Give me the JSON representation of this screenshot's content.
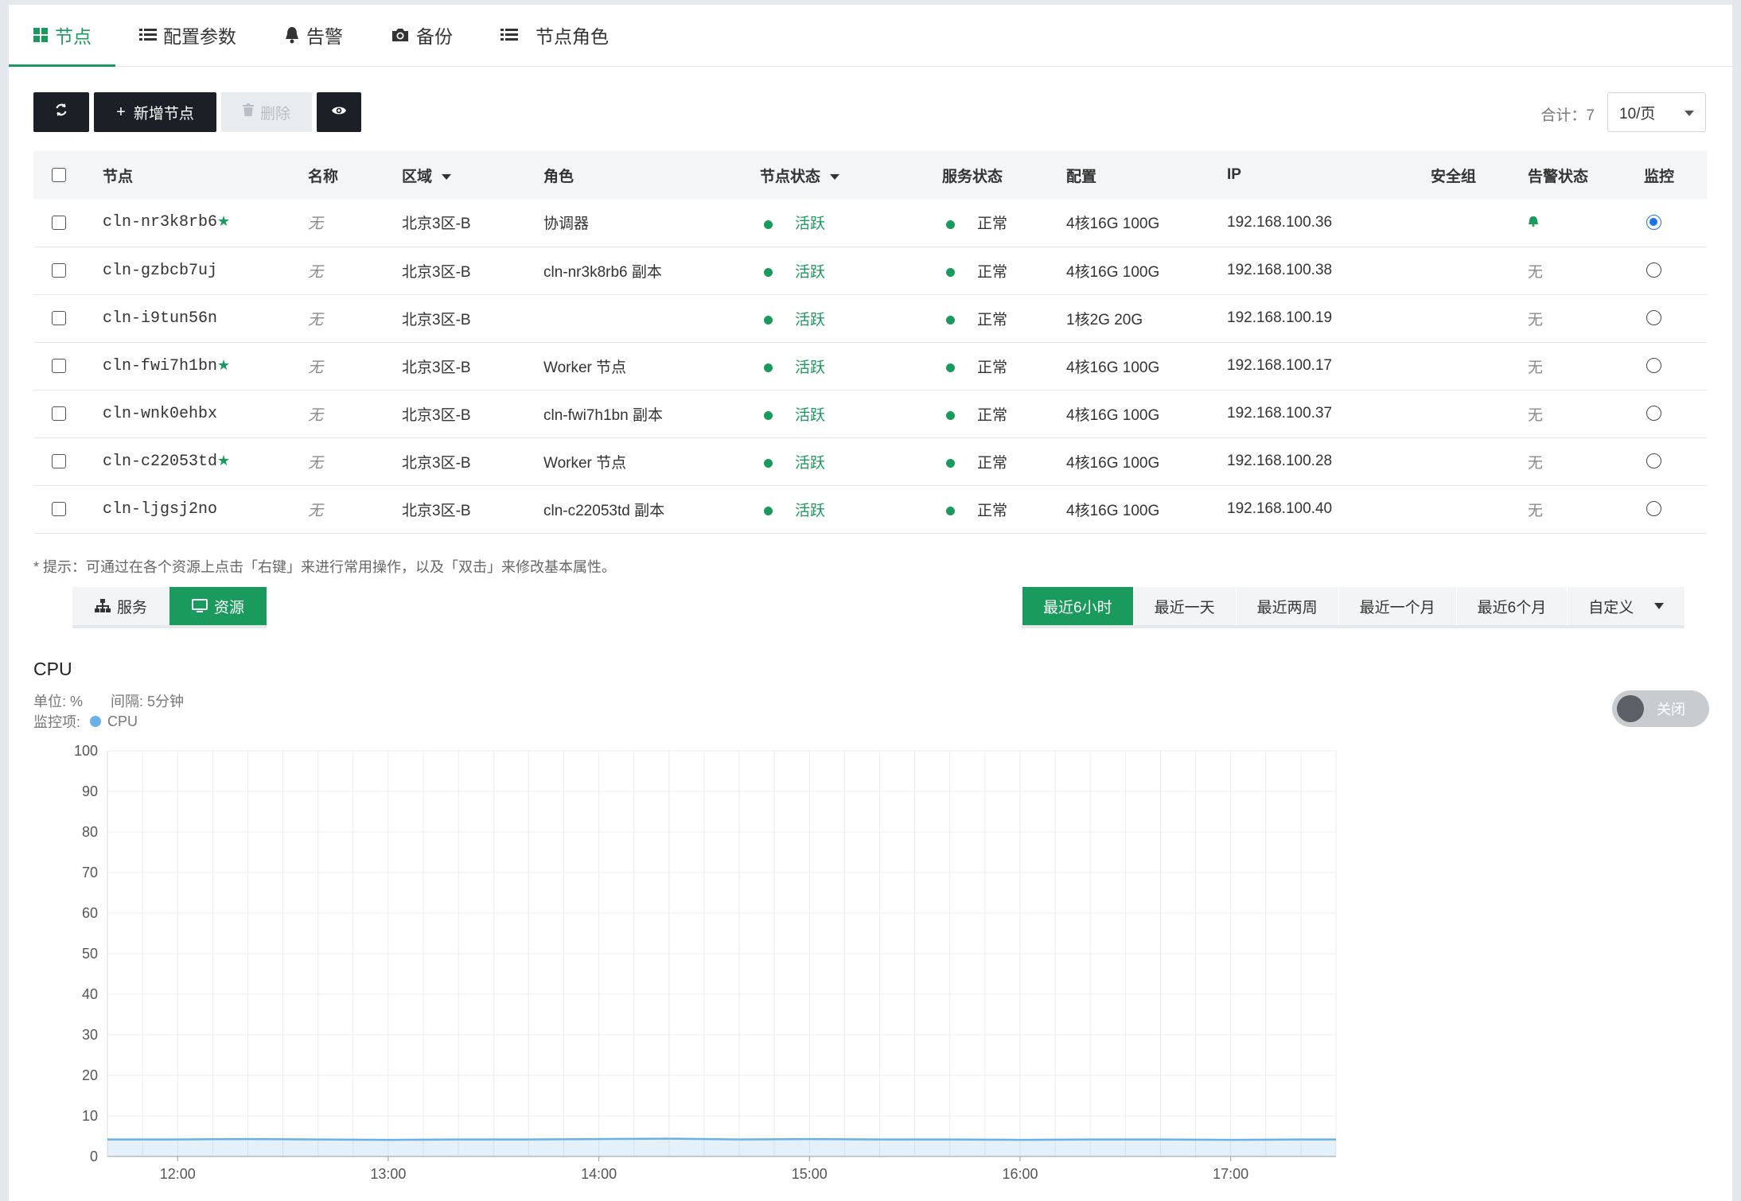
{
  "tabs": [
    {
      "label": "节点",
      "icon": "grid-icon"
    },
    {
      "label": "配置参数",
      "icon": "list-icon"
    },
    {
      "label": "告警",
      "icon": "bell-icon"
    },
    {
      "label": "备份",
      "icon": "camera-icon"
    },
    {
      "label": "节点角色",
      "icon": "list-icon"
    }
  ],
  "toolbar": {
    "add_label": "新增节点",
    "delete_label": "删除",
    "total": "合计：7",
    "per_page": "10/页"
  },
  "table": {
    "headers": [
      "节点",
      "名称",
      "区域",
      "角色",
      "节点状态",
      "服务状态",
      "配置",
      "IP",
      "安全组",
      "告警状态",
      "监控"
    ],
    "rows": [
      {
        "node": "cln-nr3k8rb6",
        "star": "★",
        "name": "无",
        "zone": "北京3区-B",
        "role": "协调器",
        "node_status": "活跃",
        "service_status": "正常",
        "config": "4核16G 100G",
        "ip": "192.168.100.36",
        "alarm": "",
        "monitor": true
      },
      {
        "node": "cln-gzbcb7uj",
        "star": "",
        "name": "无",
        "zone": "北京3区-B",
        "role": "cln-nr3k8rb6 副本",
        "node_status": "活跃",
        "service_status": "正常",
        "config": "4核16G 100G",
        "ip": "192.168.100.38",
        "alarm": "无",
        "monitor": false
      },
      {
        "node": "cln-i9tun56n",
        "star": "",
        "name": "无",
        "zone": "北京3区-B",
        "role": "",
        "node_status": "活跃",
        "service_status": "正常",
        "config": "1核2G 20G",
        "ip": "192.168.100.19",
        "alarm": "无",
        "monitor": false
      },
      {
        "node": "cln-fwi7h1bn",
        "star": "★",
        "name": "无",
        "zone": "北京3区-B",
        "role": "Worker 节点",
        "node_status": "活跃",
        "service_status": "正常",
        "config": "4核16G 100G",
        "ip": "192.168.100.17",
        "alarm": "无",
        "monitor": false
      },
      {
        "node": "cln-wnk0ehbx",
        "star": "",
        "name": "无",
        "zone": "北京3区-B",
        "role": "cln-fwi7h1bn 副本",
        "node_status": "活跃",
        "service_status": "正常",
        "config": "4核16G 100G",
        "ip": "192.168.100.37",
        "alarm": "无",
        "monitor": false
      },
      {
        "node": "cln-c22053td",
        "star": "★",
        "name": "无",
        "zone": "北京3区-B",
        "role": "Worker 节点",
        "node_status": "活跃",
        "service_status": "正常",
        "config": "4核16G 100G",
        "ip": "192.168.100.28",
        "alarm": "无",
        "monitor": false
      },
      {
        "node": "cln-ljgsj2no",
        "star": "",
        "name": "无",
        "zone": "北京3区-B",
        "role": "cln-c22053td 副本",
        "node_status": "活跃",
        "service_status": "正常",
        "config": "4核16G 100G",
        "ip": "192.168.100.40",
        "alarm": "无",
        "monitor": false
      }
    ]
  },
  "hint": "* 提示：可通过在各个资源上点击「右键」来进行常用操作，以及「双击」来修改基本属性。",
  "subtabs": [
    "服务",
    "资源"
  ],
  "ranges": [
    "最近6小时",
    "最近一天",
    "最近两周",
    "最近一个月",
    "最近6个月",
    "自定义"
  ],
  "chart_header": {
    "title": "CPU",
    "unit": "单位: %",
    "interval": "间隔: 5分钟",
    "items_label": "监控项:",
    "legend": "CPU",
    "toggle_label": "关闭"
  },
  "colors": {
    "accent": "#1a9a5c",
    "series": "#6ab0e9",
    "dark_button": "#1b2026"
  },
  "chart_data": {
    "type": "area",
    "title": "CPU",
    "ylim": [
      0,
      100
    ],
    "yticks": [
      0,
      10,
      20,
      30,
      40,
      50,
      60,
      70,
      80,
      90,
      100
    ],
    "x_ticks": [
      "12:00",
      "13:00",
      "14:00",
      "15:00",
      "16:00",
      "17:00"
    ],
    "x_range": [
      "11:40",
      "17:30"
    ],
    "grid": true,
    "series": [
      {
        "name": "CPU",
        "x": [
          "11:40",
          "12:00",
          "12:20",
          "12:40",
          "13:00",
          "13:20",
          "13:40",
          "14:00",
          "14:20",
          "14:40",
          "15:00",
          "15:20",
          "15:40",
          "16:00",
          "16:20",
          "16:40",
          "17:00",
          "17:20",
          "17:30"
        ],
        "values": [
          4.2,
          4.2,
          4.3,
          4.2,
          4.1,
          4.2,
          4.2,
          4.3,
          4.4,
          4.2,
          4.3,
          4.2,
          4.2,
          4.1,
          4.2,
          4.2,
          4.1,
          4.2,
          4.2
        ]
      }
    ]
  }
}
